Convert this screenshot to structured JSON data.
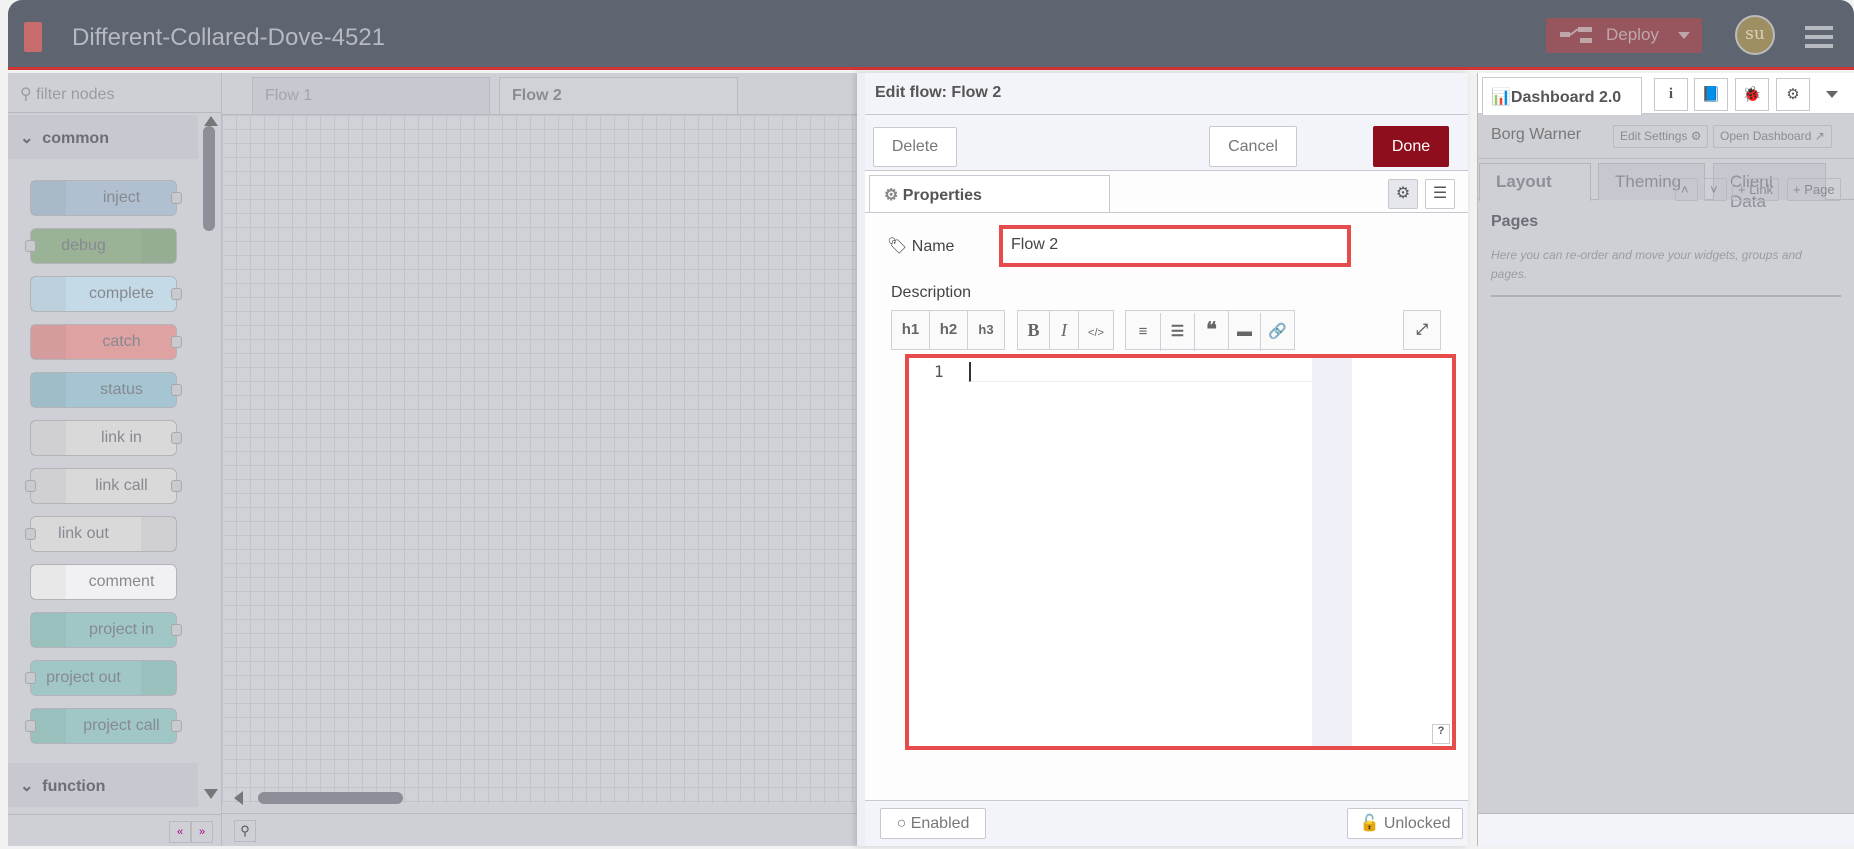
{
  "header": {
    "title": "Different-Collared-Dove-4521",
    "deploy_label": "Deploy",
    "avatar": "su",
    "accent": "#d23333"
  },
  "palette": {
    "filter_placeholder": "filter nodes",
    "categories": [
      "common",
      "function"
    ],
    "nodes": [
      {
        "label": "inject",
        "color": "#a6bbcf",
        "icon": "arrow-right-icon"
      },
      {
        "label": "debug",
        "color": "#87a980",
        "icon": "list-icon"
      },
      {
        "label": "complete",
        "color": "#c0deed",
        "icon": "exclamation-icon"
      },
      {
        "label": "catch",
        "color": "#e49191",
        "icon": "exclamation-icon"
      },
      {
        "label": "status",
        "color": "#94c1d0",
        "icon": "pulse-icon"
      },
      {
        "label": "link in",
        "color": "#dddddd",
        "icon": "link-in-icon"
      },
      {
        "label": "link call",
        "color": "#dddddd",
        "icon": "link-call-icon"
      },
      {
        "label": "link out",
        "color": "#dddddd",
        "icon": "link-out-icon"
      },
      {
        "label": "comment",
        "color": "#ffffff",
        "icon": "comment-icon"
      },
      {
        "label": "project in",
        "color": "#8ec4c0",
        "icon": "project-icon"
      },
      {
        "label": "project out",
        "color": "#8ec4c0",
        "icon": "project-icon"
      },
      {
        "label": "project call",
        "color": "#8ec4c0",
        "icon": "project-icon"
      }
    ]
  },
  "workspace": {
    "tabs": [
      "Flow 1",
      "Flow 2"
    ],
    "active_tab": "Flow 2"
  },
  "tray": {
    "title": "Edit flow: Flow 2",
    "delete": "Delete",
    "cancel": "Cancel",
    "done": "Done",
    "done_color": "#8f0e1d",
    "properties_tab": "Properties",
    "name_label": "Name",
    "name_value": "Flow 2",
    "description_label": "Description",
    "toolbar": [
      "h1",
      "h2",
      "h3",
      "B",
      "I",
      "</>"
    ],
    "line_number": "1",
    "help": "?",
    "enabled": "Enabled",
    "unlocked": "Unlocked"
  },
  "sidebar": {
    "active_tab": "Dashboard 2.0",
    "dashboard_name": "Borg Warner",
    "edit_settings": "Edit Settings",
    "open_dashboard": "Open Dashboard",
    "tabs": [
      "Layout",
      "Theming",
      "Client Data"
    ],
    "pages_heading": "Pages",
    "link_btn": "+ Link",
    "page_btn": "+ Page",
    "pages_hint": "Here you can re-order and move your widgets, groups and pages."
  }
}
